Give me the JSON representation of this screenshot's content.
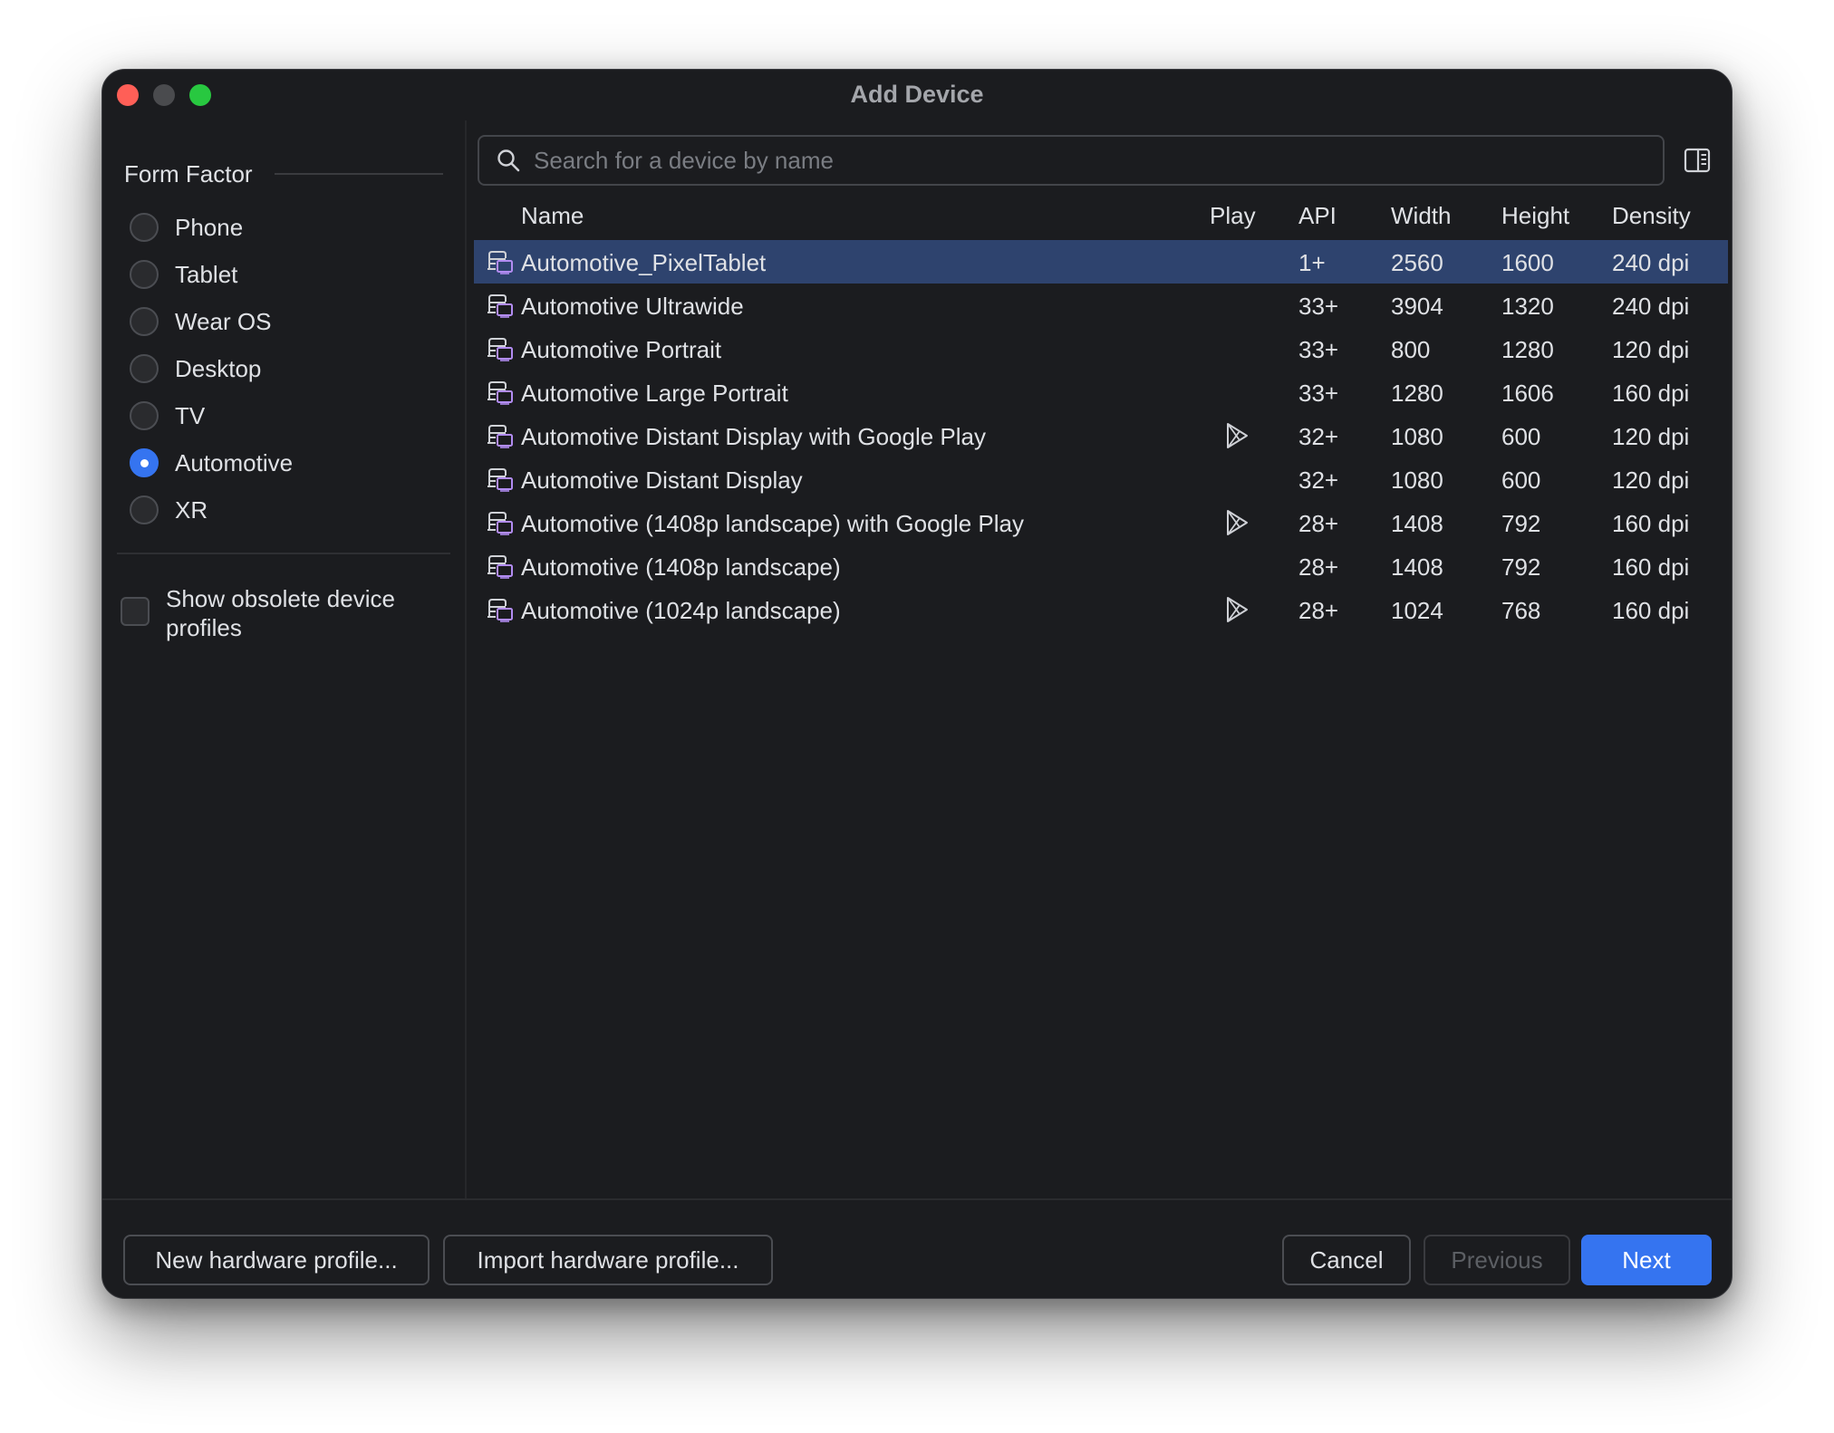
{
  "window": {
    "title": "Add Device"
  },
  "sidebar": {
    "header": "Form Factor",
    "options": [
      {
        "label": "Phone",
        "checked": false
      },
      {
        "label": "Tablet",
        "checked": false
      },
      {
        "label": "Wear OS",
        "checked": false
      },
      {
        "label": "Desktop",
        "checked": false
      },
      {
        "label": "TV",
        "checked": false
      },
      {
        "label": "Automotive",
        "checked": true
      },
      {
        "label": "XR",
        "checked": false
      }
    ],
    "obsolete_checkbox": {
      "label": "Show obsolete device profiles",
      "checked": false
    }
  },
  "search": {
    "placeholder": "Search for a device by name",
    "value": ""
  },
  "table": {
    "columns": [
      "Name",
      "Play",
      "API",
      "Width",
      "Height",
      "Density"
    ],
    "rows": [
      {
        "name": "Automotive_PixelTablet",
        "play": false,
        "api": "1+",
        "width": "2560",
        "height": "1600",
        "density": "240 dpi",
        "selected": true
      },
      {
        "name": "Automotive Ultrawide",
        "play": false,
        "api": "33+",
        "width": "3904",
        "height": "1320",
        "density": "240 dpi",
        "selected": false
      },
      {
        "name": "Automotive Portrait",
        "play": false,
        "api": "33+",
        "width": "800",
        "height": "1280",
        "density": "120 dpi",
        "selected": false
      },
      {
        "name": "Automotive Large Portrait",
        "play": false,
        "api": "33+",
        "width": "1280",
        "height": "1606",
        "density": "160 dpi",
        "selected": false
      },
      {
        "name": "Automotive Distant Display with Google Play",
        "play": true,
        "api": "32+",
        "width": "1080",
        "height": "600",
        "density": "120 dpi",
        "selected": false
      },
      {
        "name": "Automotive Distant Display",
        "play": false,
        "api": "32+",
        "width": "1080",
        "height": "600",
        "density": "120 dpi",
        "selected": false
      },
      {
        "name": "Automotive (1408p landscape) with Google Play",
        "play": true,
        "api": "28+",
        "width": "1408",
        "height": "792",
        "density": "160 dpi",
        "selected": false
      },
      {
        "name": "Automotive (1408p landscape)",
        "play": false,
        "api": "28+",
        "width": "1408",
        "height": "792",
        "density": "160 dpi",
        "selected": false
      },
      {
        "name": "Automotive (1024p landscape)",
        "play": true,
        "api": "28+",
        "width": "1024",
        "height": "768",
        "density": "160 dpi",
        "selected": false
      }
    ]
  },
  "footer": {
    "new_profile": "New hardware profile...",
    "import_profile": "Import hardware profile...",
    "cancel": "Cancel",
    "previous": "Previous",
    "next": "Next"
  },
  "colors": {
    "accent": "#3574f0",
    "selection": "#2e436e",
    "background": "#1b1c1f",
    "device_icon": "#b28cf2"
  },
  "icons": {
    "device": "automotive-device-icon",
    "play": "google-play-icon",
    "search": "search-icon",
    "panel": "panel-toggle-icon"
  }
}
